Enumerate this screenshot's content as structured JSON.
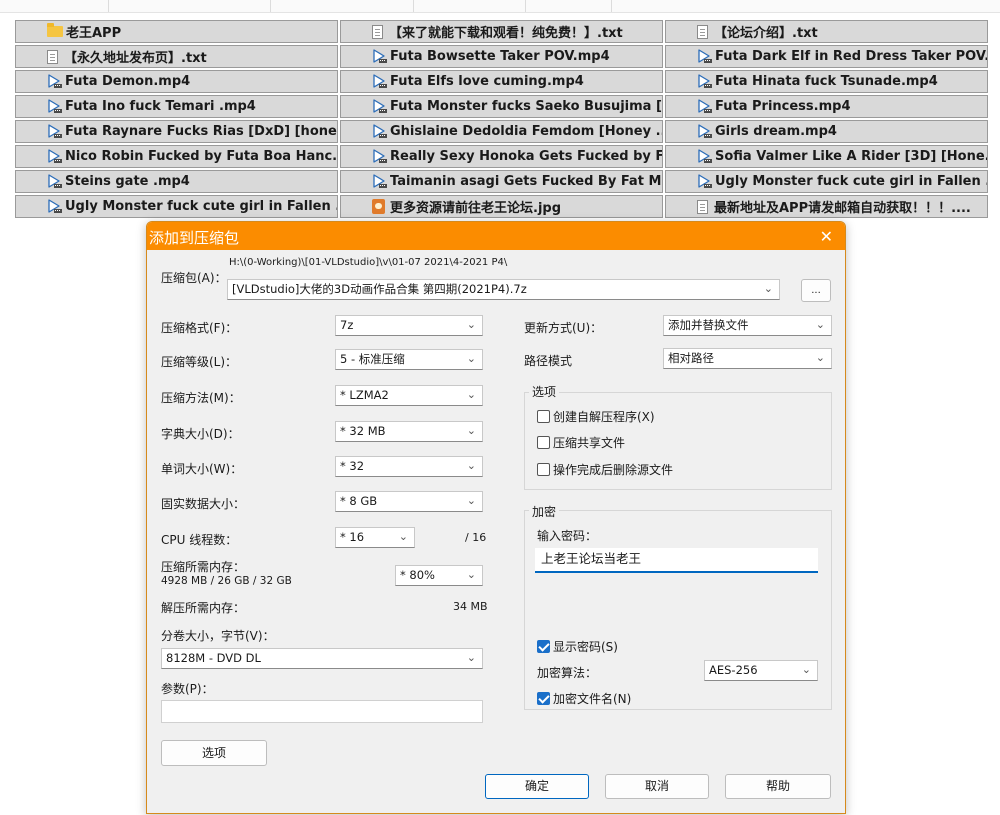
{
  "files": [
    {
      "name": "老王APP",
      "icon": "folder-icon"
    },
    {
      "name": "【来了就能下载和观看！纯免费！】.txt",
      "icon": "text-file-icon"
    },
    {
      "name": "【论坛介绍】.txt",
      "icon": "text-file-icon"
    },
    {
      "name": "【永久地址发布页】.txt",
      "icon": "text-file-icon"
    },
    {
      "name": "Futa Bowsette Taker POV.mp4",
      "icon": "video-file-icon"
    },
    {
      "name": "Futa Dark Elf in Red Dress Taker POV...",
      "icon": "video-file-icon"
    },
    {
      "name": "Futa Demon.mp4",
      "icon": "video-file-icon"
    },
    {
      "name": "Futa Elfs love cuming.mp4",
      "icon": "video-file-icon"
    },
    {
      "name": "Futa Hinata fuck Tsunade.mp4",
      "icon": "video-file-icon"
    },
    {
      "name": "Futa Ino fuck Temari .mp4",
      "icon": "video-file-icon"
    },
    {
      "name": "Futa Monster fucks Saeko Busujima [...",
      "icon": "video-file-icon"
    },
    {
      "name": "Futa Princess.mp4",
      "icon": "video-file-icon"
    },
    {
      "name": "Futa Raynare Fucks Rias [DxD] [hone...",
      "icon": "video-file-icon"
    },
    {
      "name": "Ghislaine Dedoldia Femdom [Honey ...",
      "icon": "video-file-icon"
    },
    {
      "name": "Girls dream.mp4",
      "icon": "video-file-icon"
    },
    {
      "name": "Nico Robin Fucked by Futa Boa Hanc...",
      "icon": "video-file-icon"
    },
    {
      "name": "Really Sexy Honoka Gets Fucked by F...",
      "icon": "video-file-icon"
    },
    {
      "name": "Sofia Valmer Like A Rider [3D] [Hone...",
      "icon": "video-file-icon"
    },
    {
      "name": "Steins gate .mp4",
      "icon": "video-file-icon"
    },
    {
      "name": "Taimanin asagi Gets Fucked By Fat M...",
      "icon": "video-file-icon"
    },
    {
      "name": "Ugly Monster fuck cute girl in Fallen ...",
      "icon": "video-file-icon"
    },
    {
      "name": "Ugly Monster fuck cute girl in Fallen ...",
      "icon": "video-file-icon"
    },
    {
      "name": "更多资源请前往老王论坛.jpg",
      "icon": "image-file-icon"
    },
    {
      "name": "最新地址及APP请发邮箱自动获取！！！....",
      "icon": "text-file-icon"
    }
  ],
  "dialog": {
    "title": "添加到压缩包",
    "close_glyph": "✕",
    "accent_color": "#fb8c00",
    "archive_label": "压缩包(A)：",
    "archive_path": "H:\\(0-Working)\\[01-VLDstudio]\\v\\01-07 2021\\4-2021 P4\\",
    "archive_name": "[VLDstudio]大佬的3D动画作品合集 第四期(2021P4).7z",
    "browse_label": "...",
    "format_label": "压缩格式(F)：",
    "format_value": "7z",
    "level_label": "压缩等级(L)：",
    "level_value": "5 - 标准压缩",
    "method_label": "压缩方法(M)：",
    "method_value": "* LZMA2",
    "dict_label": "字典大小(D)：",
    "dict_value": "* 32 MB",
    "word_label": "单词大小(W)：",
    "word_value": "* 32",
    "solid_label": "固实数据大小：",
    "solid_value": "* 8 GB",
    "cpu_label": "CPU 线程数：",
    "cpu_value": "* 16",
    "cpu_max": "/ 16",
    "mem_comp_label": "压缩所需内存：",
    "mem_comp_detail": "4928 MB / 26 GB / 32 GB",
    "mem_comp_value": "* 80%",
    "mem_decomp_label": "解压所需内存：",
    "mem_decomp_value": "34 MB",
    "volume_label": "分卷大小，字节(V)：",
    "volume_value": "8128M - DVD DL",
    "params_label": "参数(P)：",
    "params_value": "",
    "options_button": "选项",
    "update_label": "更新方式(U)：",
    "update_value": "添加并替换文件",
    "pathmode_label": "路径模式",
    "pathmode_value": "相对路径",
    "options_group": "选项",
    "opt_sfx": "创建自解压程序(X)",
    "opt_shared": "压缩共享文件",
    "opt_delete": "操作完成后删除源文件",
    "encrypt_group": "加密",
    "password_label": "输入密码：",
    "password_value": "上老王论坛当老王",
    "show_password": "显示密码(S)",
    "enc_method_label": "加密算法：",
    "enc_method_value": "AES-256",
    "encrypt_names": "加密文件名(N)",
    "ok": "确定",
    "cancel": "取消",
    "help": "帮助"
  }
}
